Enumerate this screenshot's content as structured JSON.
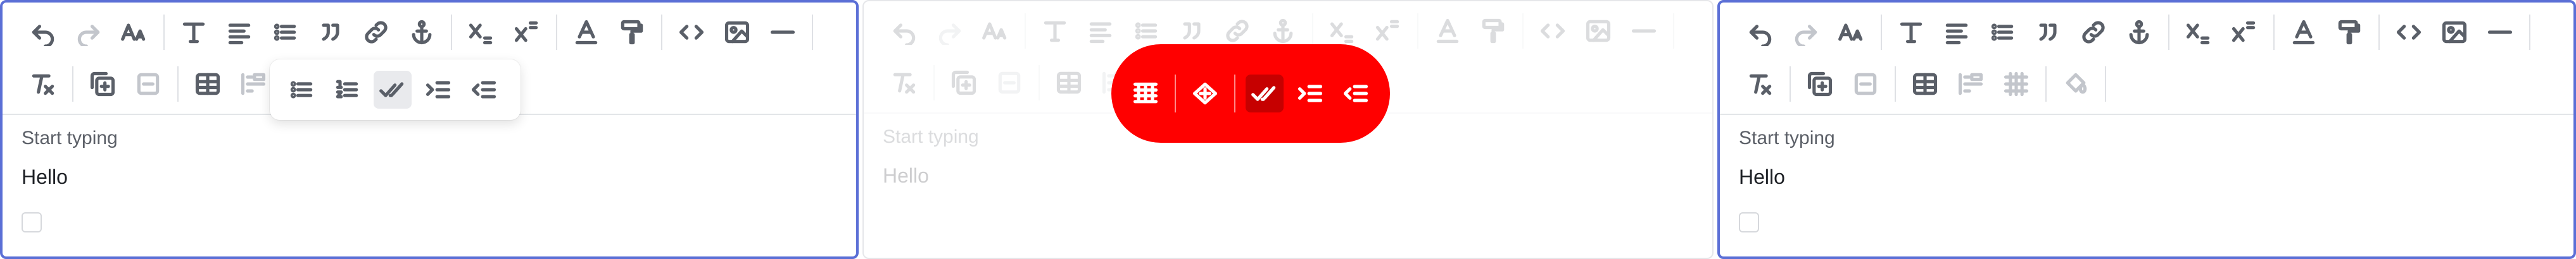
{
  "editor": {
    "placeholder_label": "Start typing",
    "body_text": "Hello"
  },
  "toolbar_icons_row1": [
    "undo-icon",
    "redo-icon",
    "font-size-icon",
    "text-style-icon",
    "align-icon",
    "bullet-list-icon",
    "blockquote-icon",
    "link-icon",
    "anchor-icon",
    "subscript-icon",
    "superscript-icon",
    "font-color-icon",
    "format-painter-icon",
    "code-icon",
    "image-icon",
    "horizontal-rule-icon"
  ],
  "toolbar_icons_row2_panel1": [
    "clear-format-icon",
    "add-block-icon",
    "remove-block-icon",
    "table-icon",
    "list-indent-icon"
  ],
  "popover_icons": [
    "bullet-list-icon",
    "ordered-list-icon",
    "task-list-icon",
    "indent-icon",
    "outdent-icon"
  ],
  "toolbar_icons_row2_panel3": [
    "clear-format-icon",
    "add-block-icon",
    "remove-block-icon",
    "table-icon",
    "list-indent-icon",
    "table-grid-icon",
    "fill-color-icon"
  ],
  "highlight": {
    "color": "#ff0000",
    "icons": [
      "table-column-icon",
      "table-settings-icon",
      "task-list-icon",
      "indent-icon",
      "outdent-icon"
    ]
  },
  "colors": {
    "focus_border": "#5b6fd6",
    "icon": "#5a5f68"
  }
}
